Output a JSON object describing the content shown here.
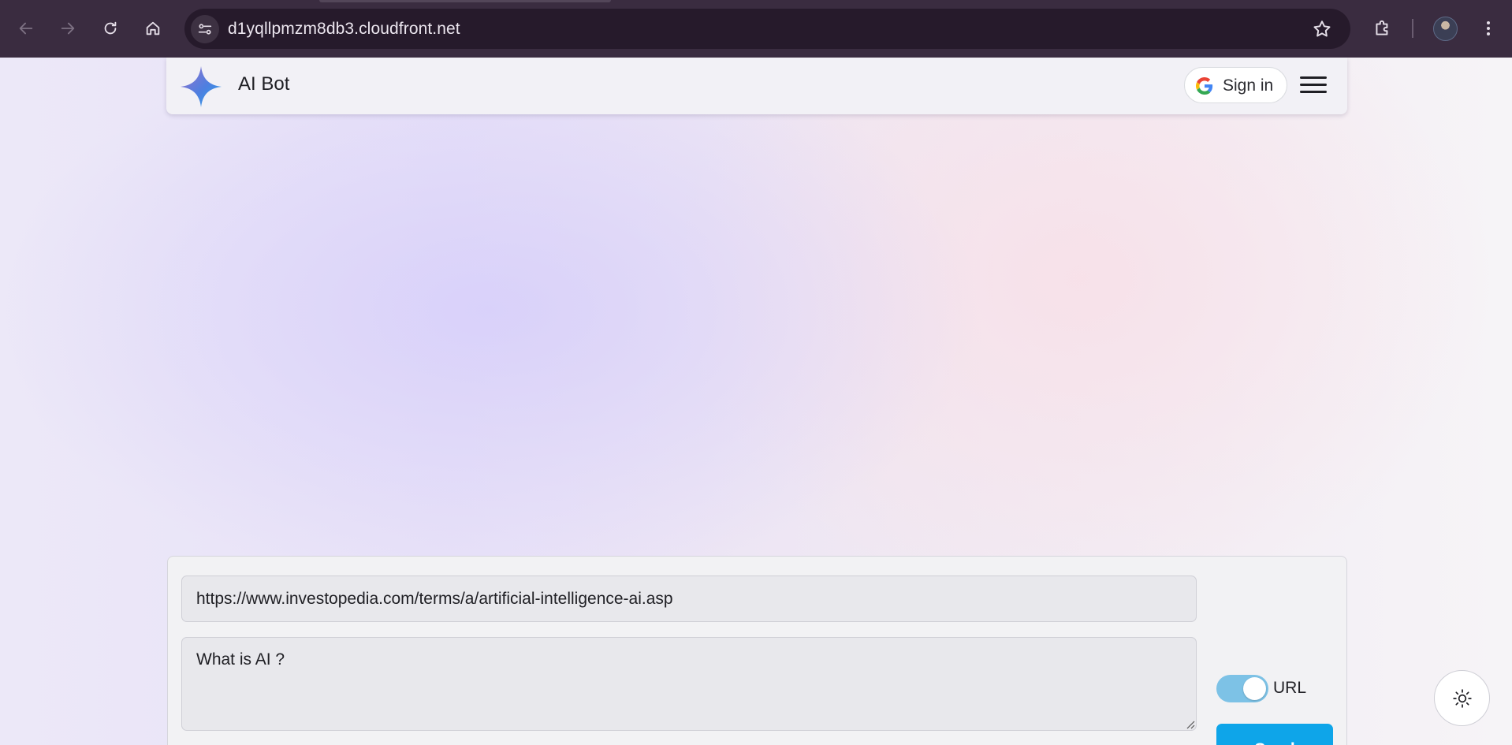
{
  "browser": {
    "url": "d1yqllpmzm8db3.cloudfront.net",
    "back_icon": "arrow-left-icon",
    "forward_icon": "arrow-right-icon",
    "reload_icon": "reload-icon",
    "home_icon": "home-icon",
    "bookmark_icon": "star-icon",
    "extensions_icon": "puzzle-icon",
    "menu_icon": "kebab-icon"
  },
  "header": {
    "brand": "AI Bot",
    "sign_in_label": "Sign in"
  },
  "form": {
    "url_value": "https://www.investopedia.com/terms/a/artificial-intelligence-ai.asp",
    "question_value": "What is AI ?",
    "toggle_label": "URL",
    "toggle_on": true,
    "send_label": "Send"
  },
  "colors": {
    "accent": "#0ea5e9",
    "toggle_on": "#7dc2e6"
  }
}
